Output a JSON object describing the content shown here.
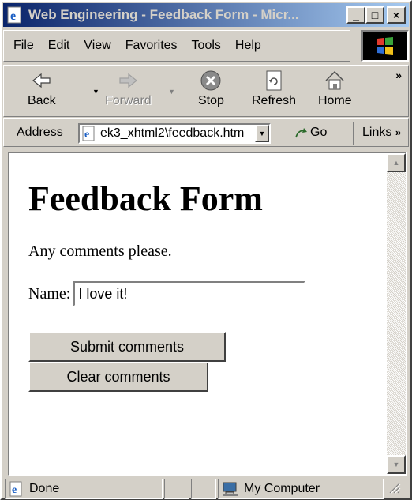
{
  "window": {
    "title": "Web Engineering - Feedback Form - Micr...",
    "buttons": {
      "minimize": "_",
      "maximize": "□",
      "close": "×"
    }
  },
  "menu": {
    "items": [
      {
        "label": "File"
      },
      {
        "label": "Edit"
      },
      {
        "label": "View"
      },
      {
        "label": "Favorites"
      },
      {
        "label": "Tools"
      },
      {
        "label": "Help"
      }
    ]
  },
  "toolbar": {
    "back": "Back",
    "forward": "Forward",
    "stop": "Stop",
    "refresh": "Refresh",
    "home": "Home",
    "more": "»"
  },
  "address": {
    "label": "Address",
    "value": "ek3_xhtml2\\feedback.htm",
    "go": "Go",
    "links": "Links"
  },
  "page": {
    "heading": "Feedback Form",
    "intro": "Any comments please.",
    "name_label": "Name:",
    "name_value": "I love it!",
    "submit_label": "Submit comments",
    "clear_label": "Clear comments"
  },
  "status": {
    "text": "Done",
    "zone": "My Computer"
  }
}
